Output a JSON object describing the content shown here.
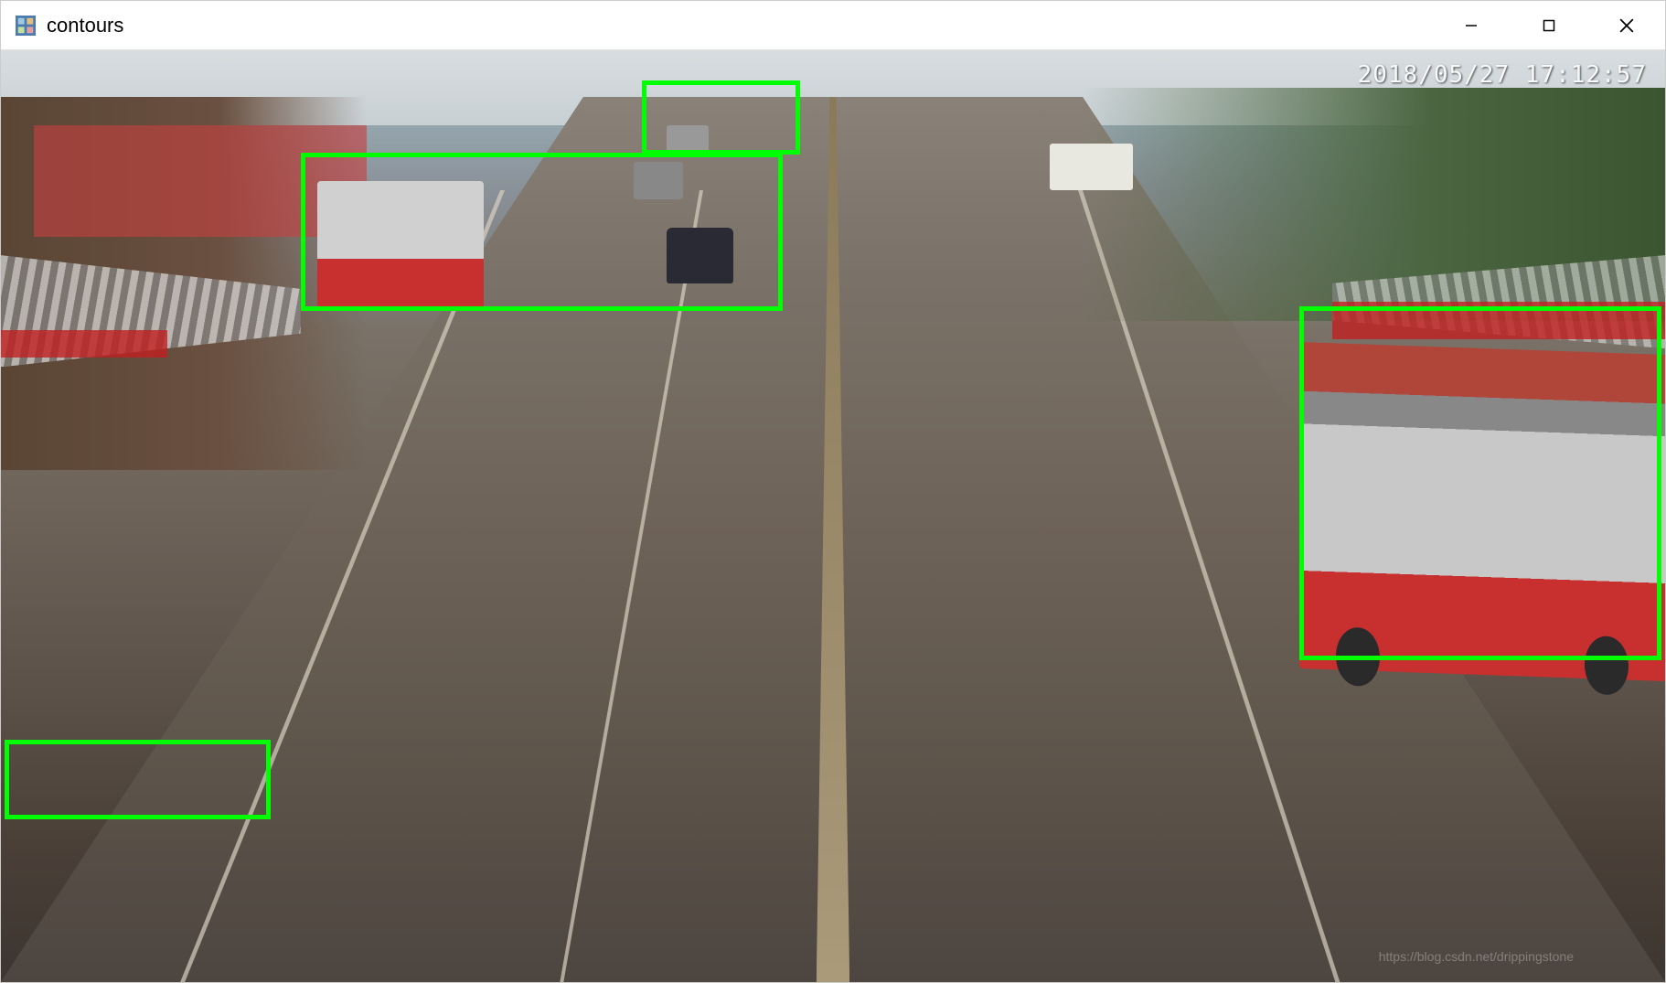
{
  "window": {
    "title": "contours"
  },
  "overlay": {
    "timestamp": "2018/05/27 17:12:57",
    "top_left_text": "",
    "bottom_right_text": ""
  },
  "contours": [
    {
      "top_pct": 3.2,
      "left_pct": 38.5,
      "width_pct": 9.5,
      "height_pct": 8.0
    },
    {
      "top_pct": 11.0,
      "left_pct": 18.0,
      "width_pct": 29.0,
      "height_pct": 17.0
    },
    {
      "top_pct": 27.5,
      "left_pct": 78.0,
      "width_pct": 21.8,
      "height_pct": 38.0
    },
    {
      "top_pct": 74.0,
      "left_pct": 0.2,
      "width_pct": 16.0,
      "height_pct": 8.5
    }
  ],
  "colors": {
    "contour_stroke": "#00ff00",
    "bus_red": "#c83030",
    "road": "#6b625a"
  }
}
